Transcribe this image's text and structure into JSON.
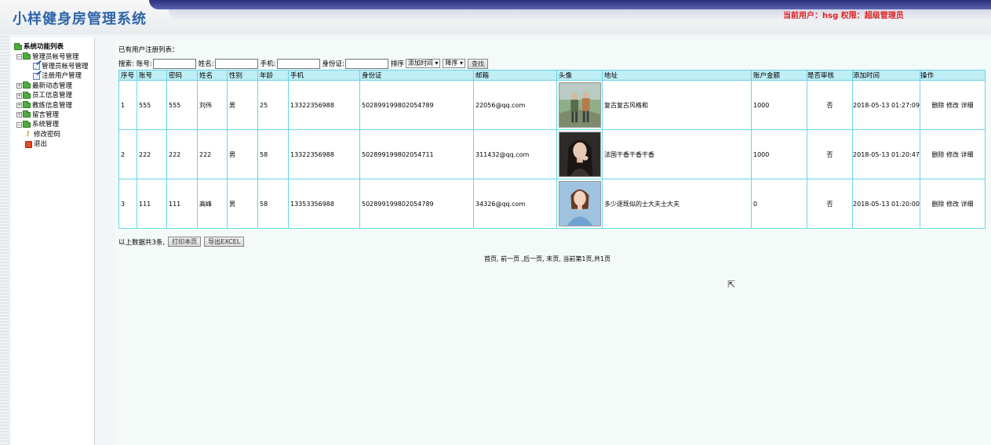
{
  "header": {
    "title": "小样健身房管理系统",
    "user_info": "当前用户：hsg  权限：超级管理员"
  },
  "sidebar": {
    "root": "系统功能列表",
    "items": [
      {
        "label": "管理员帐号管理",
        "type": "folder"
      },
      {
        "label": "管理员帐号管理",
        "type": "child"
      },
      {
        "label": "注册用户管理",
        "type": "child"
      },
      {
        "label": "最新动态管理",
        "type": "folder"
      },
      {
        "label": "员工信息管理",
        "type": "folder"
      },
      {
        "label": "教练信息管理",
        "type": "folder"
      },
      {
        "label": "留言管理",
        "type": "folder"
      },
      {
        "label": "系统管理",
        "type": "folder"
      },
      {
        "label": "修改密码",
        "type": "leaf-key"
      },
      {
        "label": "退出",
        "type": "leaf-exit"
      }
    ]
  },
  "main": {
    "section_title": "已有用户注册列表：",
    "search": {
      "label": "搜索:",
      "account_label": "账号:",
      "name_label": "姓名:",
      "phone_label": "手机:",
      "idcard_label": "身份证:",
      "sort_label": "排序",
      "sort_field": "添加时间 ▾",
      "sort_order": "降序 ▾",
      "search_button": "查找"
    },
    "table": {
      "headers": [
        "序号",
        "账号",
        "密码",
        "姓名",
        "性别",
        "年龄",
        "手机",
        "身份证",
        "邮箱",
        "头像",
        "地址",
        "账户金额",
        "是否审核",
        "添加时间",
        "操作"
      ],
      "rows": [
        {
          "no": "1",
          "account": "555",
          "password": "555",
          "name": "刘伟",
          "gender": "男",
          "age": "25",
          "phone": "13322356988",
          "idcard": "502899199802054789",
          "email": "22056@qq.com",
          "avatar": "hikers-photo",
          "address": "复古复古风格和",
          "balance": "1000",
          "audited": "否",
          "added": "2018-05-13 01:27:09"
        },
        {
          "no": "2",
          "account": "222",
          "password": "222",
          "name": "222",
          "gender": "男",
          "age": "58",
          "phone": "13322356988",
          "idcard": "502899199802054711",
          "email": "311432@qq.com",
          "avatar": "woman-portrait-dark",
          "address": "法国干香干香干香",
          "balance": "1000",
          "audited": "否",
          "added": "2018-05-13 01:20:47"
        },
        {
          "no": "3",
          "account": "111",
          "password": "111",
          "name": "高峰",
          "gender": "男",
          "age": "58",
          "phone": "13353356988",
          "idcard": "502899199802054789",
          "email": "34326@qq.com",
          "avatar": "woman-portrait-blue",
          "address": "多少逐既似的士大夫士大夫",
          "balance": "0",
          "audited": "否",
          "added": "2018-05-13 01:20:00"
        }
      ],
      "actions": {
        "delete": "删除",
        "edit": "修改",
        "detail": "详细"
      }
    },
    "footer": {
      "summary": "以上数据共3条,",
      "print_button": "打印本页",
      "export_button": "导出EXCEL"
    },
    "pager": "首页, 前一页 ,后一页, 末页, 当前第1页,共1页"
  }
}
